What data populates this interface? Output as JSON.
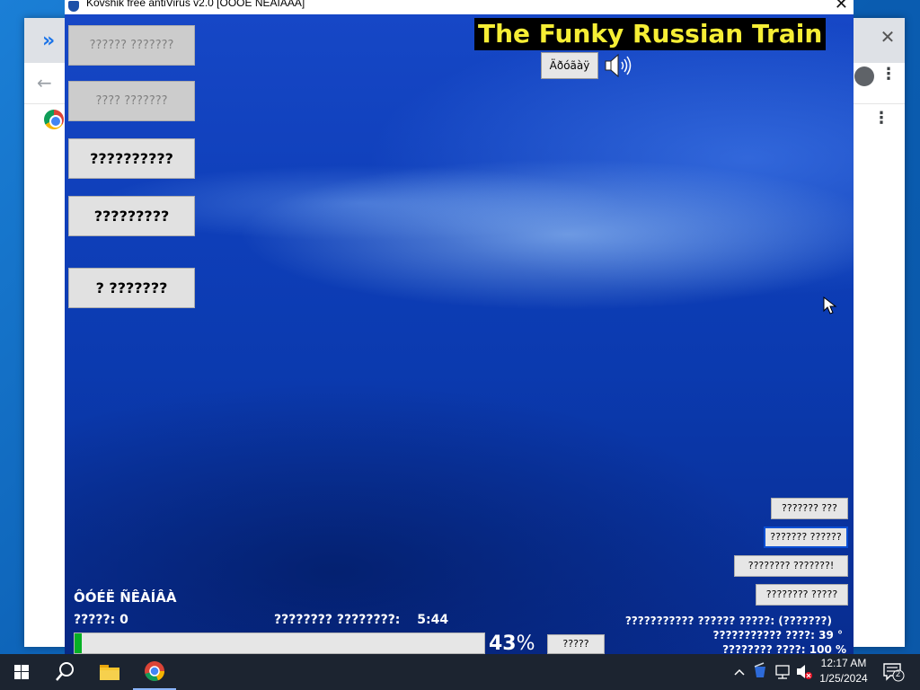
{
  "app": {
    "window_title": "Kovshik free antiVirus v2.0 [ÒÓÔÈ ÑÊÀÍÀÀÀ]",
    "headline": "The Funky Russian Train",
    "play_button_label": "Äðóãàÿ",
    "side_buttons": [
      {
        "label": "?????? ???????",
        "enabled": false
      },
      {
        "label": "???? ???????",
        "enabled": false
      },
      {
        "label": "??????????",
        "enabled": true
      },
      {
        "label": "?????????",
        "enabled": true
      },
      {
        "label": "? ???????",
        "enabled": true
      }
    ],
    "right_buttons": [
      {
        "label": "??????? ???"
      },
      {
        "label": "??????? ??????"
      },
      {
        "label": "???????? ???????!"
      },
      {
        "label": "???????? ?????"
      }
    ],
    "status": {
      "title": "ÔÓÉË ÑÊÀÍÂÀ",
      "found_label": "?????:",
      "found_value": "0",
      "remaining_label": "???????? ????????:",
      "remaining_value": "5:44",
      "progress_percent": 43,
      "progress_text": "43",
      "percent_sign": "%",
      "stop_label": "?????",
      "info_lines": [
        "??????????? ?????? ?????: (???????)",
        "??????????? ????:   39    °",
        "???????? ????:  100 %"
      ]
    }
  },
  "taskbar": {
    "clock_time": "12:17 AM",
    "clock_date": "1/25/2024",
    "notification_count": "2"
  },
  "colors": {
    "headline_text": "#f6ee35",
    "progress_fill": "#06b025",
    "taskbar": "#1c2430"
  }
}
